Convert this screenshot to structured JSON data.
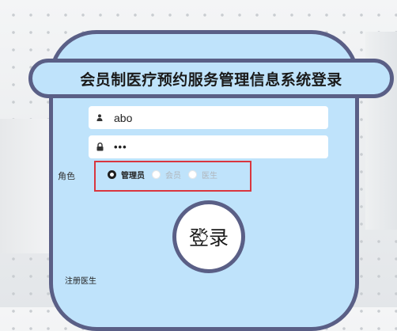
{
  "title": "会员制医疗预约服务管理信息系统登录",
  "form": {
    "username": {
      "value": "abo",
      "icon": "user-icon"
    },
    "password": {
      "value": "•••",
      "icon": "lock-icon"
    },
    "role_label": "角色",
    "roles": [
      {
        "label": "管理员",
        "selected": true
      },
      {
        "label": "会员",
        "selected": false
      },
      {
        "label": "医生",
        "selected": false
      }
    ]
  },
  "login_button": "登录",
  "register_link": "注册医生",
  "colors": {
    "card_fill": "#bfe3fb",
    "card_border": "#5a5f86",
    "highlight_border": "#d9363e"
  }
}
